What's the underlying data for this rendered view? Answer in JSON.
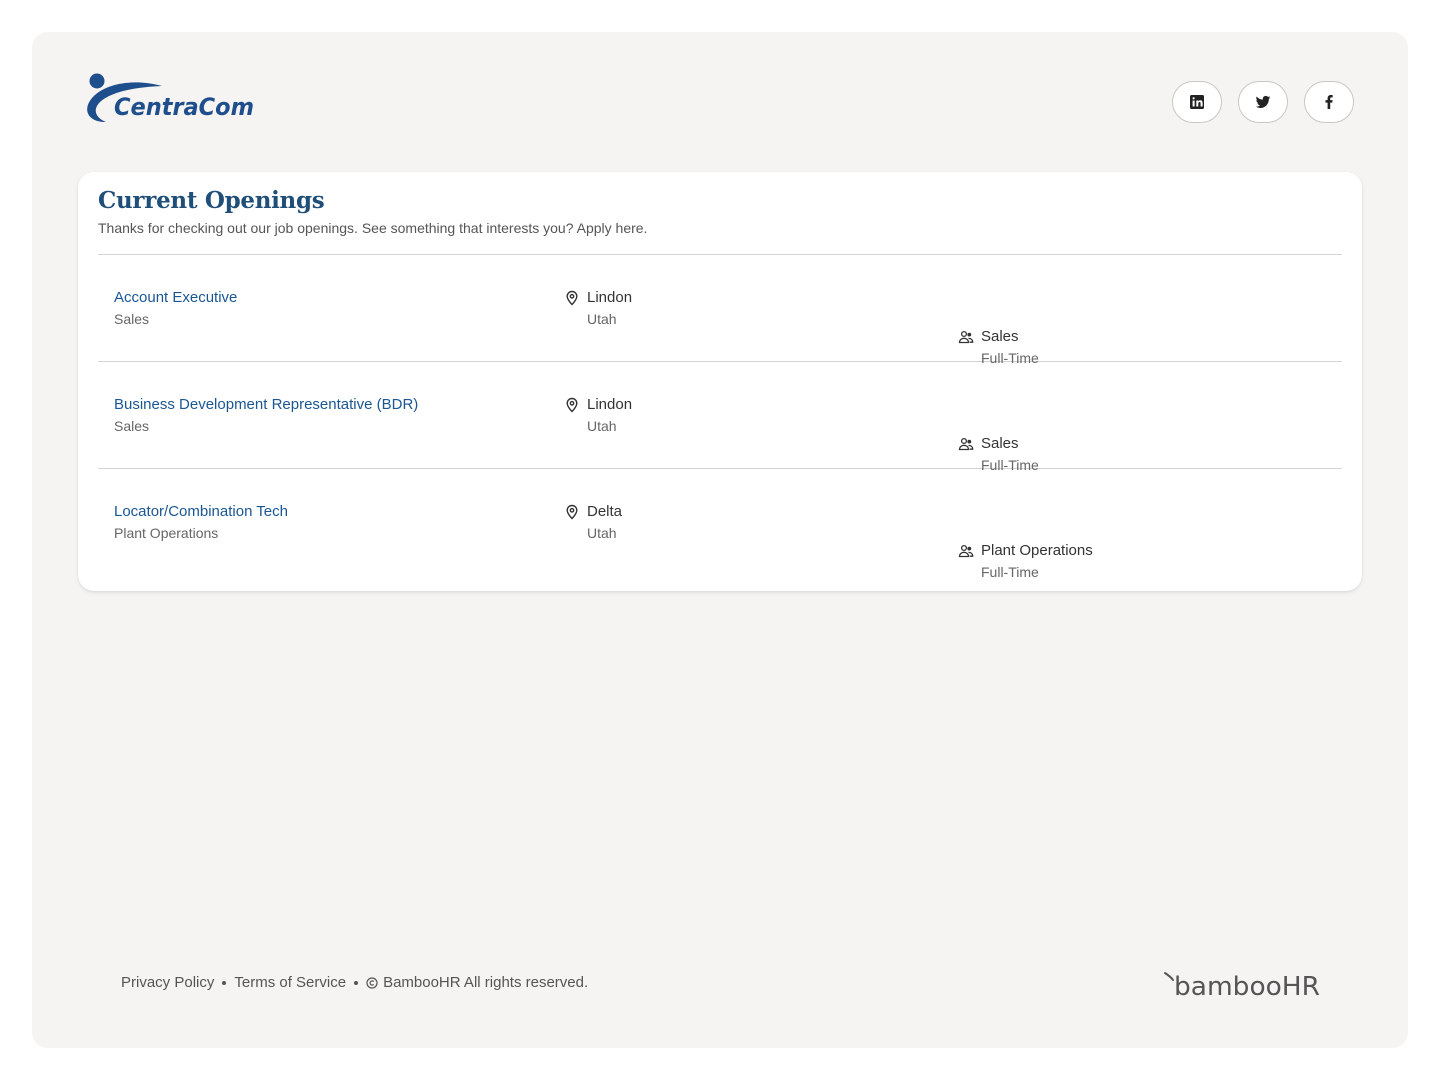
{
  "brand": {
    "company": "CentraCom",
    "logo_color": "#1f4e8c",
    "social": [
      {
        "name": "linkedin",
        "icon": "linkedin-icon"
      },
      {
        "name": "twitter",
        "icon": "twitter-icon"
      },
      {
        "name": "facebook",
        "icon": "facebook-icon"
      }
    ]
  },
  "openings": {
    "title": "Current Openings",
    "subtitle": "Thanks for checking out our job openings. See something that interests you? Apply here.",
    "jobs": [
      {
        "title": "Account Executive",
        "department": "Sales",
        "city": "Lindon",
        "state": "Utah",
        "team": "Sales",
        "type": "Full-Time"
      },
      {
        "title": "Business Development Representative (BDR)",
        "department": "Sales",
        "city": "Lindon",
        "state": "Utah",
        "team": "Sales",
        "type": "Full-Time"
      },
      {
        "title": "Locator/Combination Tech",
        "department": "Plant Operations",
        "city": "Delta",
        "state": "Utah",
        "team": "Plant Operations",
        "type": "Full-Time"
      }
    ]
  },
  "footer": {
    "privacy": "Privacy Policy",
    "terms": "Terms of Service",
    "copyright": "BambooHR All rights reserved.",
    "powered_by": "bambooHR"
  },
  "colors": {
    "accent": "#1a5694",
    "title": "#1f4e79",
    "background": "#f5f4f2",
    "card": "#ffffff"
  }
}
